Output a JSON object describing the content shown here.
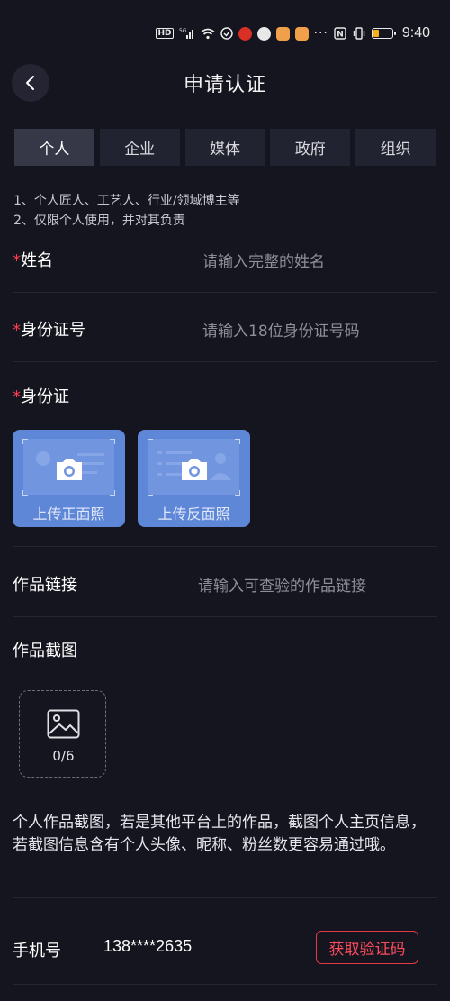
{
  "status_bar": {
    "hd_label": "HD",
    "network_label": "5G",
    "more_dots": "···",
    "nfc_label": "N",
    "time": "9:40",
    "battery_level": 0.3
  },
  "header": {
    "title": "申请认证"
  },
  "tabs": [
    {
      "label": "个人",
      "active": true
    },
    {
      "label": "企业",
      "active": false
    },
    {
      "label": "媒体",
      "active": false
    },
    {
      "label": "政府",
      "active": false
    },
    {
      "label": "组织",
      "active": false
    }
  ],
  "description": {
    "line1": "1、个人匠人、工艺人、行业/领域博主等",
    "line2": "2、仅限个人使用，并对其负责"
  },
  "form": {
    "required_mark": "*",
    "name": {
      "label": "姓名",
      "placeholder": "请输入完整的姓名"
    },
    "id_number": {
      "label": "身份证号",
      "placeholder": "请输入18位身份证号码"
    },
    "id_card": {
      "label": "身份证",
      "upload_front": "上传正面照",
      "upload_back": "上传反面照"
    },
    "work_link": {
      "label": "作品链接",
      "placeholder": "请输入可查验的作品链接"
    },
    "work_screenshot": {
      "label": "作品截图",
      "count": "0/6"
    },
    "screenshot_hint": "个人作品截图，若是其他平台上的作品，截图个人主页信息，若截图信息含有个人头像、昵称、粉丝数更容易通过哦。",
    "phone": {
      "label": "手机号",
      "value": "138****2635",
      "code_button": "获取验证码"
    }
  },
  "colors": {
    "background": "#15151f",
    "required": "#ff3b52",
    "upload_card": "#5f87d8",
    "code_button": "#e2384a"
  }
}
